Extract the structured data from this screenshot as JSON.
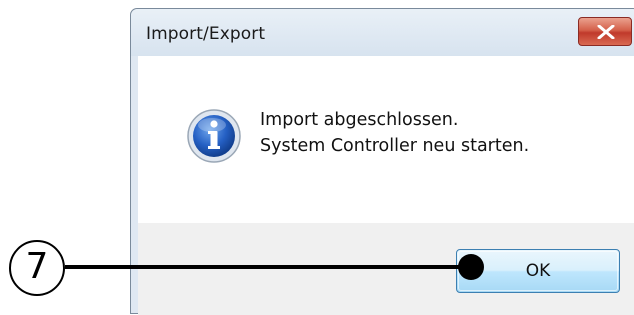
{
  "dialog": {
    "title": "Import/Export",
    "message_line1": "Import abgeschlossen.",
    "message_line2": "System Controller neu starten.",
    "icon": "info-icon",
    "ok_label": "OK",
    "close_icon": "close-icon"
  },
  "callout": {
    "number": "7"
  },
  "colors": {
    "close_button": "#c0392b",
    "ok_button_border": "#3c7fb1",
    "info_icon": "#1f5fbf"
  }
}
